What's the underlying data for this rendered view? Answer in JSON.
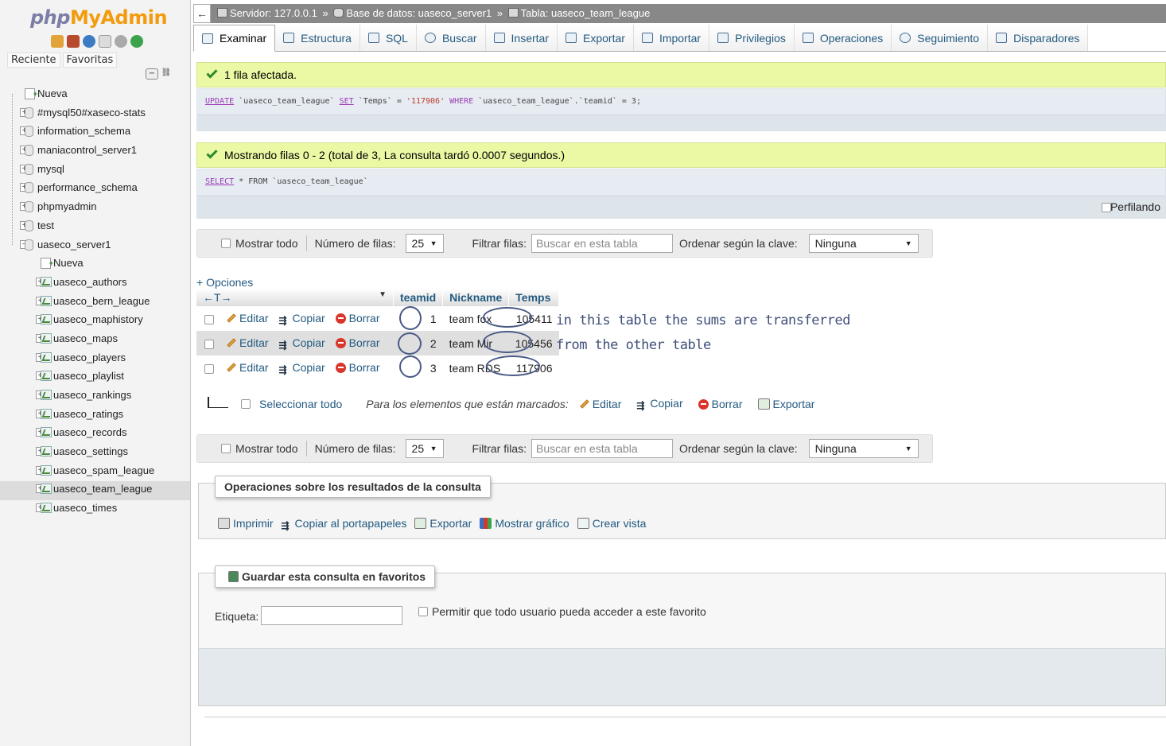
{
  "app": {
    "logo_php": "php",
    "logo_myadmin": "MyAdmin"
  },
  "nav": {
    "tabs": [
      "Reciente",
      "Favoritas"
    ],
    "new_label": "Nueva",
    "databases": [
      "#mysql50#xaseco-stats",
      "information_schema",
      "maniacontrol_server1",
      "mysql",
      "performance_schema",
      "phpmyadmin",
      "test",
      "uaseco_server1"
    ],
    "table_new_label": "Nueva",
    "tables": [
      "uaseco_authors",
      "uaseco_bern_league",
      "uaseco_maphistory",
      "uaseco_maps",
      "uaseco_players",
      "uaseco_playlist",
      "uaseco_rankings",
      "uaseco_ratings",
      "uaseco_records",
      "uaseco_settings",
      "uaseco_spam_league",
      "uaseco_team_league",
      "uaseco_times"
    ],
    "selected_table": "uaseco_team_league"
  },
  "breadcrumb": {
    "server": "Servidor: 127.0.0.1",
    "database": "Base de datos: uaseco_server1",
    "table": "Tabla: uaseco_team_league",
    "separator": "»"
  },
  "tabs": [
    "Examinar",
    "Estructura",
    "SQL",
    "Buscar",
    "Insertar",
    "Exportar",
    "Importar",
    "Privilegios",
    "Operaciones",
    "Seguimiento",
    "Disparadores"
  ],
  "notice1": {
    "message": "1 fila afectada.",
    "sql_kw1": "UPDATE",
    "sql_mid1": "`uaseco_team_league`",
    "sql_kw2": "SET",
    "sql_mid2": "`Temps` =",
    "sql_str": "'117906'",
    "sql_kw3": "WHERE",
    "sql_tail": "`uaseco_team_league`.`teamid` = 3;"
  },
  "notice2": {
    "message": "Mostrando filas 0 - 2 (total de 3, La consulta tardó 0.0007 segundos.)",
    "sql_kw1": "SELECT",
    "sql_tail": "* FROM `uaseco_team_league`",
    "profiling": "Perfilando"
  },
  "navbar": {
    "show_all": "Mostrar todo",
    "rows_label": "Número de filas:",
    "rows_value": "25",
    "filter_label": "Filtrar filas:",
    "filter_placeholder": "Buscar en esta tabla",
    "sort_label": "Ordenar según la clave:",
    "sort_value": "Ninguna"
  },
  "options_link": "+ Opciones",
  "table": {
    "columns": [
      "teamid",
      "Nickname",
      "Temps"
    ],
    "actions": {
      "edit": "Editar",
      "copy": "Copiar",
      "delete": "Borrar"
    },
    "rows": [
      {
        "teamid": "1",
        "nickname": "team fox",
        "temps": "105411"
      },
      {
        "teamid": "2",
        "nickname": "team Mir",
        "temps": "105456"
      },
      {
        "teamid": "3",
        "nickname": "team RDS",
        "temps": "117906"
      }
    ]
  },
  "annotation": {
    "line1": "in this table the sums are transferred",
    "line2": "from the other table"
  },
  "bulk": {
    "select_all": "Seleccionar todo",
    "marked_label": "Para los elementos que están marcados:",
    "edit": "Editar",
    "copy": "Copiar",
    "delete": "Borrar",
    "export": "Exportar"
  },
  "query_ops": {
    "title": "Operaciones sobre los resultados de la consulta",
    "print": "Imprimir",
    "copy_clipboard": "Copiar al portapapeles",
    "export": "Exportar",
    "chart": "Mostrar gráfico",
    "create_view": "Crear vista"
  },
  "bookmark": {
    "title": "Guardar esta consulta en favoritos",
    "label": "Etiqueta:",
    "allow_all": "Permitir que todo usuario pueda acceder a este favorito"
  }
}
